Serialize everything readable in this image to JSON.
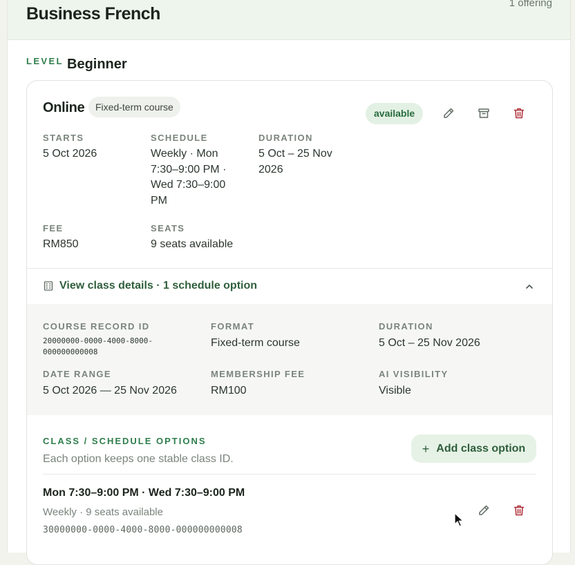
{
  "course": {
    "title": "Business French",
    "offering_count": "1 offering"
  },
  "level": {
    "label": "LEVEL",
    "value": "Beginner"
  },
  "offering": {
    "mode": "Online",
    "type_tag": "Fixed-term course",
    "status": "available",
    "fields": {
      "starts_label": "STARTS",
      "starts_value": "5 Oct 2026",
      "schedule_label": "SCHEDULE",
      "schedule_lines": [
        "Weekly · Mon",
        "7:30–9:00 PM ·",
        "Wed 7:30–9:00",
        "PM"
      ],
      "duration_label": "DURATION",
      "duration_lines": [
        "5 Oct – 25 Nov",
        "2026"
      ],
      "fee_label": "FEE",
      "fee_value": "RM850",
      "seats_label": "SEATS",
      "seats_value": "9 seats available"
    }
  },
  "details": {
    "toggle_text": "View class details · 1 schedule option",
    "record_id_label": "COURSE RECORD ID",
    "record_id_lines": [
      "20000000-0000-4000-8000-",
      "000000000008"
    ],
    "format_label": "FORMAT",
    "format_value": "Fixed-term course",
    "duration_label": "DURATION",
    "duration_value": "5 Oct – 25 Nov 2026",
    "date_range_label": "DATE RANGE",
    "date_range_value": "5 Oct 2026 — 25 Nov 2026",
    "membership_fee_label": "MEMBERSHIP FEE",
    "membership_fee_value": "RM100",
    "ai_visibility_label": "AI VISIBILITY",
    "ai_visibility_value": "Visible"
  },
  "class_options": {
    "label": "CLASS / SCHEDULE OPTIONS",
    "description": "Each option keeps one stable class ID.",
    "add_button": "Add class option",
    "items": [
      {
        "title": "Mon 7:30–9:00 PM · Wed 7:30–9:00 PM",
        "subtitle": "Weekly · 9 seats available",
        "class_id": "30000000-0000-4000-8000-000000000008"
      }
    ]
  },
  "colors": {
    "accent": "#2e7d4b",
    "header_bg": "#eef5ec",
    "badge_bg": "#e3f1e4",
    "delete_red": "#b0313a"
  },
  "icons": [
    "edit-icon",
    "archive-icon",
    "trash-icon",
    "building-icon",
    "chevron-up-icon",
    "plus-icon",
    "mouse-cursor-icon"
  ]
}
